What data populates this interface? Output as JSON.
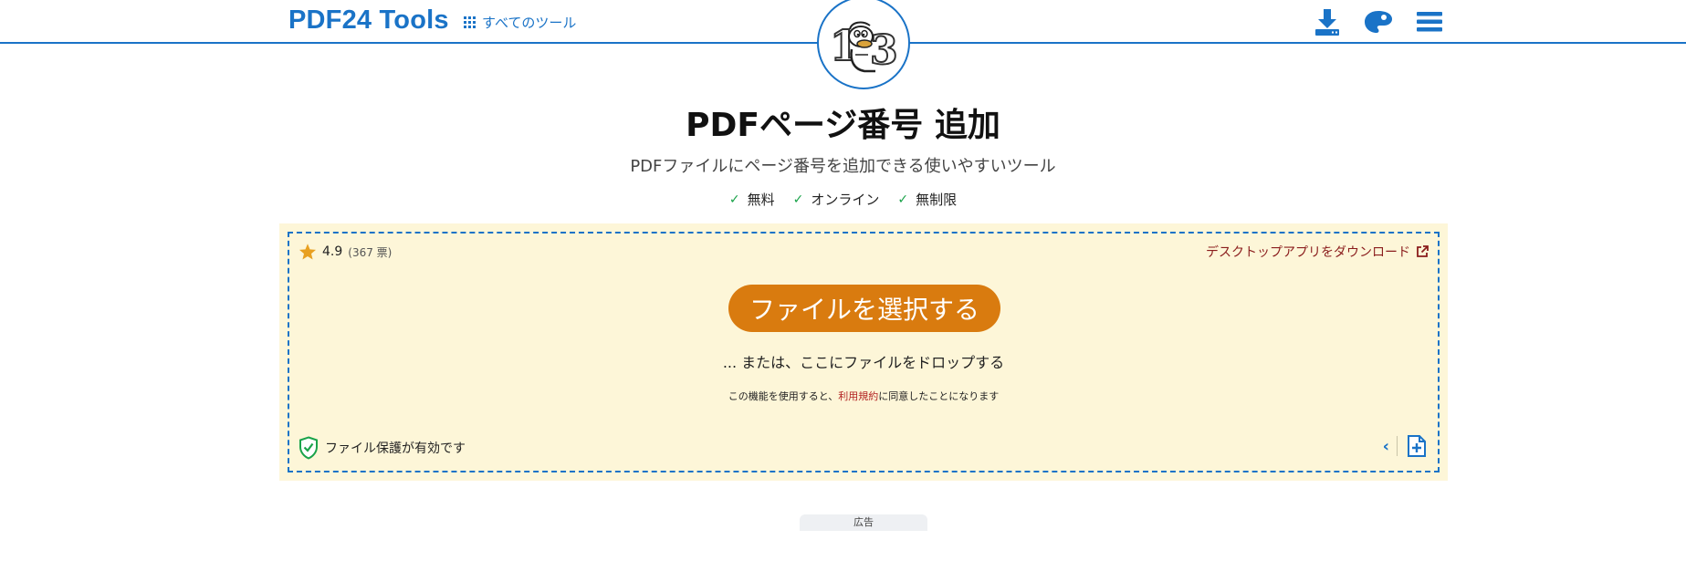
{
  "header": {
    "brand": "PDF24 Tools",
    "all_tools_label": "すべてのツール",
    "icons": [
      "download-icon",
      "palette-icon",
      "menu-icon"
    ]
  },
  "logo": {
    "icon": "pdf24-mascot-123-logo"
  },
  "page": {
    "title": "PDFページ番号 追加",
    "subtitle": "PDFファイルにページ番号を追加できる使いやすいツール",
    "features": [
      "無料",
      "オンライン",
      "無制限"
    ]
  },
  "upload": {
    "rating_value": "4.9",
    "rating_votes": "(367 票)",
    "desktop_link": "デスクトップアプリをダウンロード",
    "select_button": "ファイルを選択する",
    "drop_text": "... または、ここにファイルをドロップする",
    "terms_before": "この機能を使用すると、",
    "terms_link": "利用規約",
    "terms_after": "に同意したことになります",
    "protection_text": "ファイル保護が有効です"
  },
  "ad": {
    "label": "広告"
  },
  "colors": {
    "accent": "#1a73c7",
    "button": "#d97b0f",
    "upload_bg": "#fdf6d8",
    "link_red": "#8a1c1c",
    "check_green": "#1aa34a",
    "star": "#e8a020"
  }
}
